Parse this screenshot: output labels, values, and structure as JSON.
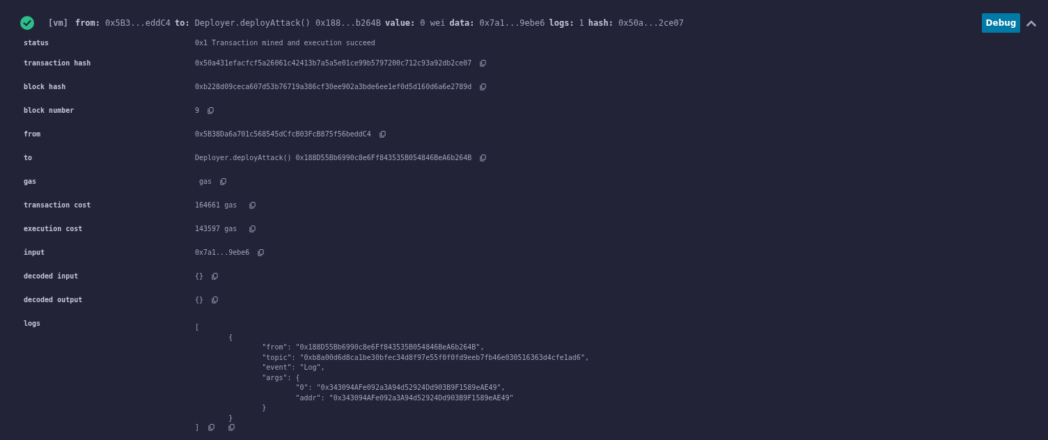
{
  "header": {
    "succeeded": true,
    "tag": "[vm]",
    "fields": [
      {
        "label": "from:",
        "value": "0x5B3...eddC4"
      },
      {
        "label": "to:",
        "value": "Deployer.deployAttack() 0x188...b264B"
      },
      {
        "label": "value:",
        "value": "0 wei"
      },
      {
        "label": "data:",
        "value": "0x7a1...9ebe6"
      },
      {
        "label": "logs:",
        "value": "1"
      },
      {
        "label": "hash:",
        "value": "0x50a...2ce07"
      }
    ],
    "debug_button": "Debug",
    "expanded": true
  },
  "rows": [
    {
      "kind": "text",
      "label": "status",
      "value": "0x1 Transaction mined and execution succeed"
    },
    {
      "kind": "copyable",
      "label": "transaction hash",
      "value": "0x50a431efacfcf5a26061c42413b7a5a5e01ce99b5797200c712c93a92db2ce07"
    },
    {
      "kind": "copyable",
      "label": "block hash",
      "value": "0xb228d09ceca607d53b76719a386cf30ee902a3bde6ee1ef0d5d160d6a6e2789d"
    },
    {
      "kind": "copyable",
      "label": "block number",
      "value": "9"
    },
    {
      "kind": "copyable",
      "label": "from",
      "value": "0x5B38Da6a701c568545dCfcB03FcB875f56beddC4"
    },
    {
      "kind": "copyable",
      "label": "to",
      "value": "Deployer.deployAttack() 0x188D55Bb6990c8e6Ff843535B054846BeA6b264B"
    },
    {
      "kind": "copyable",
      "label": "gas",
      "value": " gas"
    },
    {
      "kind": "copyable",
      "label": "transaction cost",
      "value": "164661 gas "
    },
    {
      "kind": "copyable",
      "label": "execution cost",
      "value": "143597 gas "
    },
    {
      "kind": "copyable",
      "label": "input",
      "value": "0x7a1...9ebe6"
    },
    {
      "kind": "copyable",
      "label": "decoded input",
      "value": "{}"
    },
    {
      "kind": "copyable",
      "label": "decoded output",
      "value": "{}"
    },
    {
      "kind": "json",
      "label": "logs",
      "value": "[\n\t{\n\t\t\"from\": \"0x188D55Bb6990c8e6Ff843535B054846BeA6b264B\",\n\t\t\"topic\": \"0xb8a00d6d8ca1be30bfec34d8f97e55f0f0fd9eeb7fb46e030516363d4cfe1ad6\",\n\t\t\"event\": \"Log\",\n\t\t\"args\": {\n\t\t\t\"0\": \"0x343094AFe092a3A94d52924Dd903B9F1589eAE49\",\n\t\t\t\"addr\": \"0x343094AFe092a3A94d52924Dd903B9F1589eAE49\"\n\t\t}\n\t}\n]"
    }
  ]
}
